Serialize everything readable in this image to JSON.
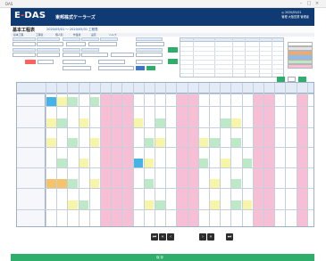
{
  "window": {
    "title": "DAS"
  },
  "header": {
    "logo_main": "E",
    "logo_dash": "-",
    "logo_rest": "DAS",
    "company": "東邦株式ケーラーズ",
    "right_line1": "◎ 2020/05/01",
    "right_line2": "管理  大阪営業  管理者"
  },
  "page": {
    "title": "基本工程表",
    "subtitle": "2020/05/01 ～ 2020/05/31 工程表"
  },
  "nav": [
    "基本工程",
    "工程表",
    "個人別",
    "作業者",
    "設定",
    "ヘルプ"
  ],
  "pager": {
    "first": "⏮",
    "prev2": "«",
    "prev": "‹",
    "next": "›",
    "next2": "»",
    "last": "⏭"
  },
  "footer": {
    "button": "保 存"
  },
  "colors": {
    "header_bg": "#103a73",
    "pink": "#f7bfd6",
    "yellow": "#f6f5a8",
    "green": "#bde9c7",
    "blue": "#46b3e6",
    "orange": "#f5c36b",
    "accent_green": "#2fae6b"
  }
}
